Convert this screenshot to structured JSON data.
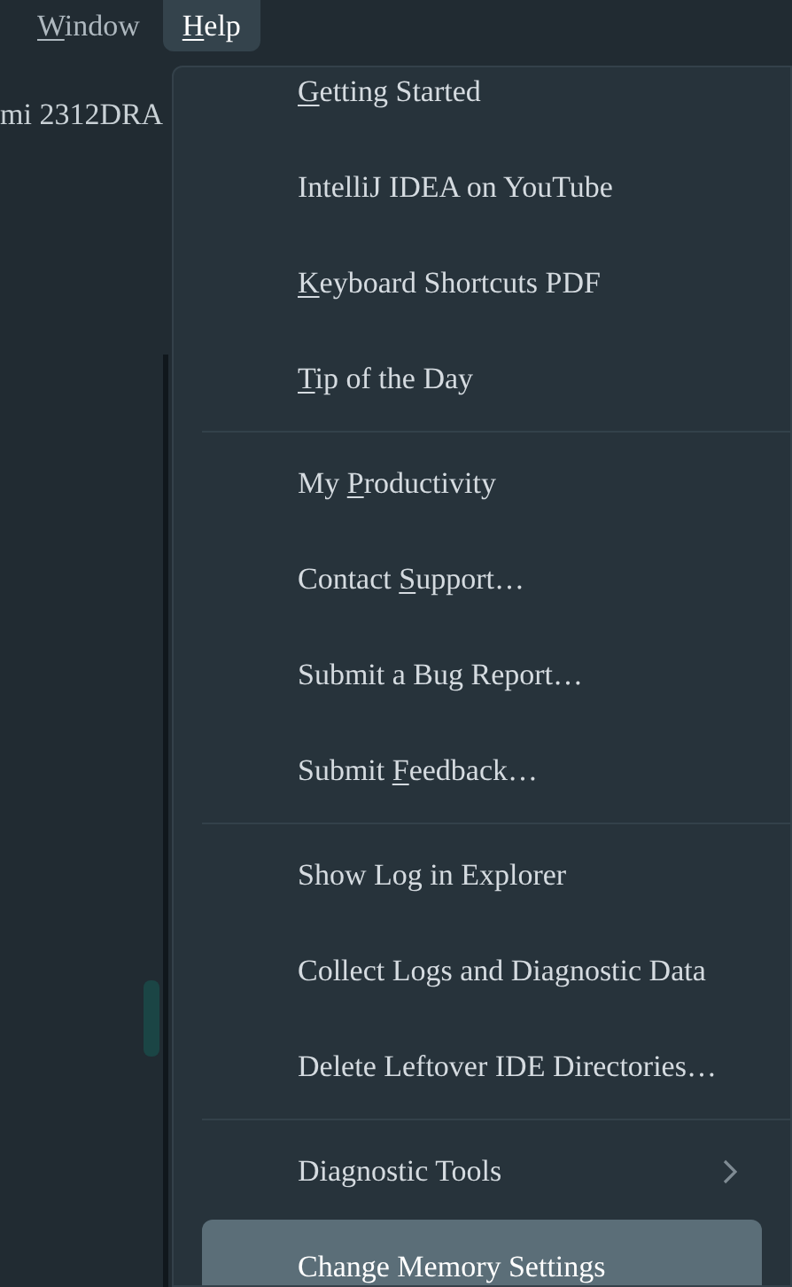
{
  "menu_bar": [
    {
      "mnemonic": "W",
      "label_end": "indow",
      "selected": false
    },
    {
      "mnemonic": "H",
      "label_end": "elp",
      "selected": true
    }
  ],
  "background": {
    "device_label": "mi 2312DRA"
  },
  "help_menu": {
    "groups": [
      [
        {
          "mnemonic": "G",
          "label_end": "etting Started",
          "selected": false,
          "submenu": false
        },
        {
          "label_start": "IntelliJ IDEA on YouTube",
          "selected": false,
          "submenu": false
        },
        {
          "mnemonic": "K",
          "label_end": "eyboard Shortcuts PDF",
          "selected": false,
          "submenu": false
        },
        {
          "mnemonic": "T",
          "label_end": "ip of the Day",
          "selected": false,
          "submenu": false
        }
      ],
      [
        {
          "label_start": "My ",
          "mnemonic": "P",
          "label_end": "roductivity",
          "selected": false,
          "submenu": false
        },
        {
          "label_start": "Contact ",
          "mnemonic": "S",
          "label_end": "upport…",
          "selected": false,
          "submenu": false
        },
        {
          "label_start": "Submit a Bug Report…",
          "selected": false,
          "submenu": false
        },
        {
          "label_start": "Submit ",
          "mnemonic": "F",
          "label_end": "eedback…",
          "selected": false,
          "submenu": false
        }
      ],
      [
        {
          "label_start": "Show Log in Explorer",
          "selected": false,
          "submenu": false
        },
        {
          "label_start": "Collect Logs and Diagnostic Data",
          "selected": false,
          "submenu": false
        },
        {
          "label_start": "Delete Leftover IDE Directories…",
          "selected": false,
          "submenu": false
        }
      ],
      [
        {
          "label_start": "Diagnostic Tools",
          "selected": false,
          "submenu": true
        },
        {
          "label_start": "Change Memory Settings",
          "selected": true,
          "submenu": false
        }
      ]
    ]
  }
}
